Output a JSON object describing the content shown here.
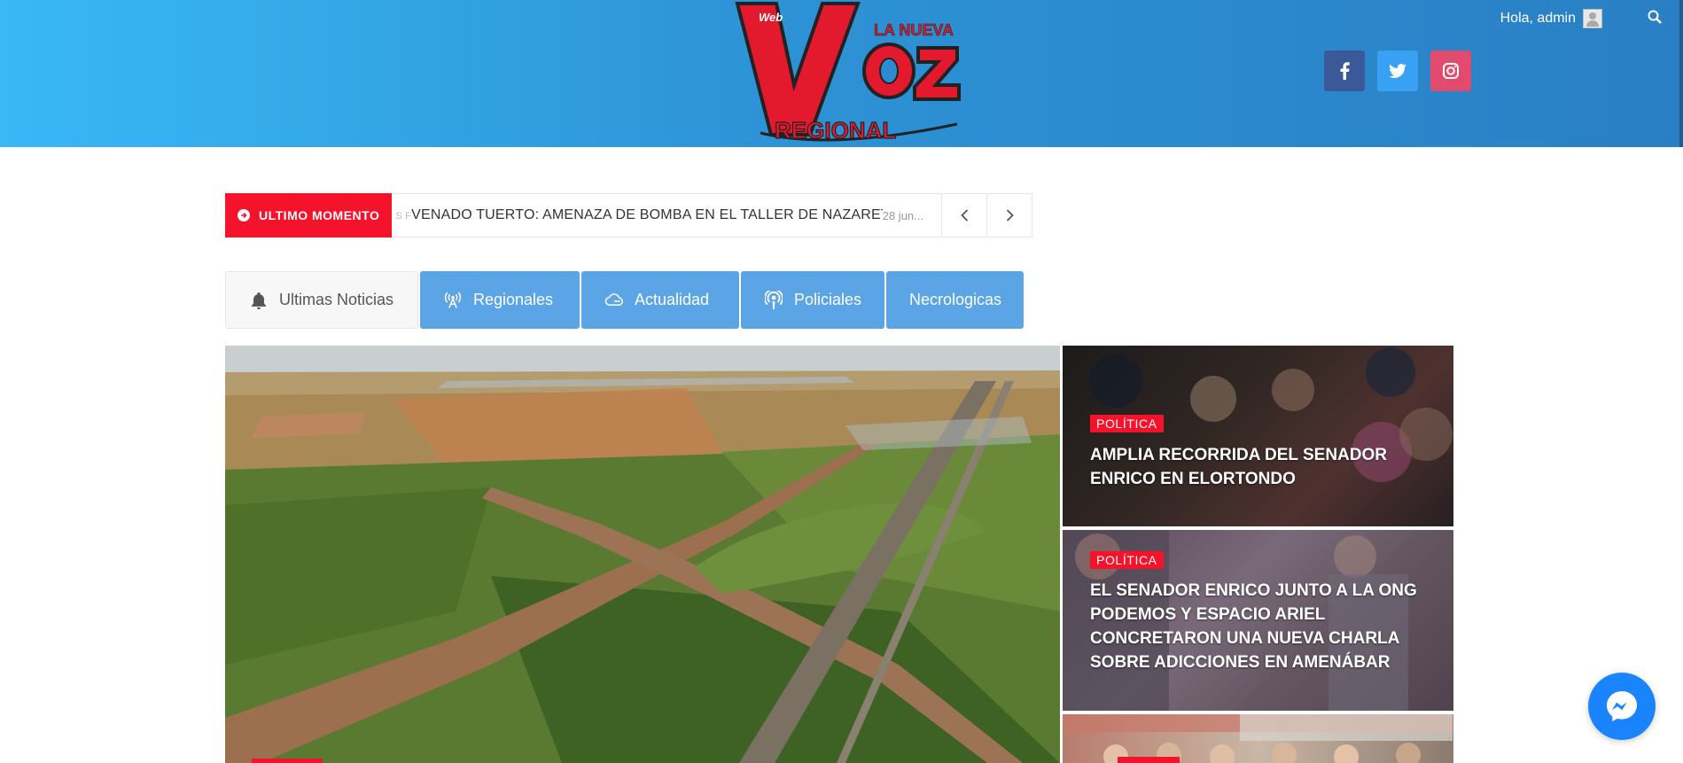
{
  "header": {
    "greeting": "Hola, admin",
    "logo_text": {
      "top_tag": "Web",
      "la_nueva": "LA NUEVA",
      "voz": "Voz",
      "regional": "REGIONAL"
    },
    "social": [
      "facebook-icon",
      "twitter-icon",
      "instagram-icon"
    ],
    "colors": {
      "header_start": "#39b8f5",
      "header_end": "#2a7fc4",
      "facebook": "#3b5998",
      "twitter": "#38a1f3",
      "instagram": "#e14b6e"
    }
  },
  "ticker": {
    "label": "ULTIMO MOMENTO",
    "partial_prev": "S F",
    "headline": "VENADO TUERTO: AMENAZA DE BOMBA EN EL TALLER DE NAZARETH",
    "date": "28 jun..."
  },
  "tabs": [
    {
      "label": "Ultimas Noticias",
      "icon": "bell-icon"
    },
    {
      "label": "Regionales",
      "icon": "broadcast-icon"
    },
    {
      "label": "Actualidad",
      "icon": "cloud-icon"
    },
    {
      "label": "Policiales",
      "icon": "podcast-icon"
    },
    {
      "label": "Necrologicas",
      "icon": ""
    }
  ],
  "cards": [
    {
      "category": "POLÍTICA",
      "title": "AMPLIA RECORRIDA DEL SENADOR ENRICO EN ELORTONDO"
    },
    {
      "category": "POLÍTICA",
      "title": "EL SENADOR ENRICO JUNTO A LA ONG PODEMOS Y ESPACIO ARIEL CONCRETARON UNA NUEVA CHARLA SOBRE ADICCIONES EN AMENÁBAR"
    }
  ],
  "accent": "#f5122b",
  "tab_color": "#5ba4e5"
}
